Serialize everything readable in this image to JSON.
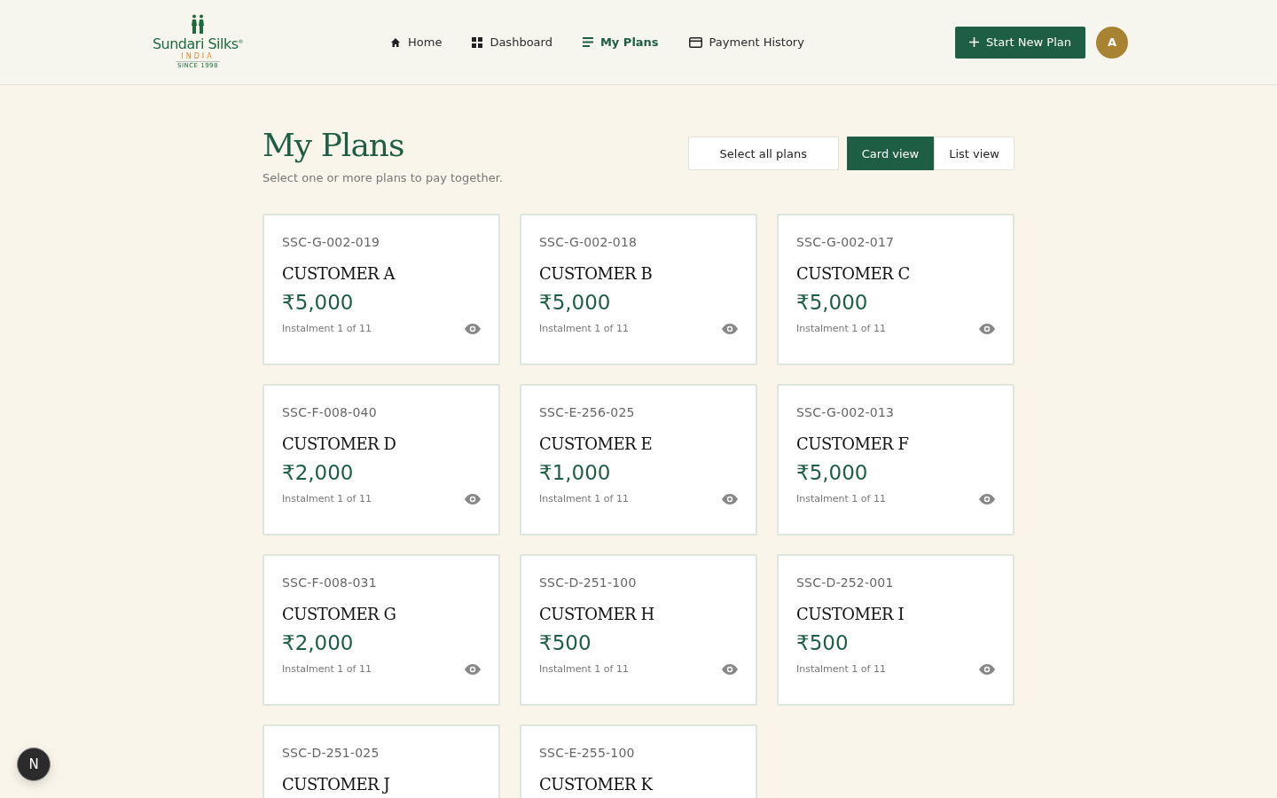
{
  "header": {
    "logo": {
      "name": "Sundari Silks",
      "mark": "®",
      "country": "INDIA",
      "since": "SINCE 1998"
    },
    "nav": [
      {
        "label": "Home",
        "selected": false
      },
      {
        "label": "Dashboard",
        "selected": false
      },
      {
        "label": "My Plans",
        "selected": true
      },
      {
        "label": "Payment History",
        "selected": false
      }
    ],
    "action": "Start New Plan",
    "avatar": "A"
  },
  "page": {
    "title": "My Plans",
    "subtitle": "Select one or more plans to pay together.",
    "select_all": "Select all plans",
    "views": [
      {
        "label": "Card view",
        "selected": true
      },
      {
        "label": "List view",
        "selected": false
      }
    ]
  },
  "plans": [
    {
      "code": "SSC-G-002-019",
      "customer": "CUSTOMER A",
      "amount": "₹5,000",
      "instalment": "Instalment 1 of 11"
    },
    {
      "code": "SSC-G-002-018",
      "customer": "CUSTOMER B",
      "amount": "₹5,000",
      "instalment": "Instalment 1 of 11"
    },
    {
      "code": "SSC-G-002-017",
      "customer": "CUSTOMER C",
      "amount": "₹5,000",
      "instalment": "Instalment 1 of 11"
    },
    {
      "code": "SSC-F-008-040",
      "customer": "CUSTOMER D",
      "amount": "₹2,000",
      "instalment": "Instalment 1 of 11"
    },
    {
      "code": "SSC-E-256-025",
      "customer": "CUSTOMER E",
      "amount": "₹1,000",
      "instalment": "Instalment 1 of 11"
    },
    {
      "code": "SSC-G-002-013",
      "customer": "CUSTOMER F",
      "amount": "₹5,000",
      "instalment": "Instalment 1 of 11"
    },
    {
      "code": "SSC-F-008-031",
      "customer": "CUSTOMER G",
      "amount": "₹2,000",
      "instalment": "Instalment 1 of 11"
    },
    {
      "code": "SSC-D-251-100",
      "customer": "CUSTOMER H",
      "amount": "₹500",
      "instalment": "Instalment 1 of 11"
    },
    {
      "code": "SSC-D-252-001",
      "customer": "CUSTOMER I",
      "amount": "₹500",
      "instalment": "Instalment 1 of 11"
    },
    {
      "code": "SSC-D-251-025",
      "customer": "CUSTOMER J"
    },
    {
      "code": "SSC-E-255-100",
      "customer": "CUSTOMER K"
    }
  ],
  "dev_badge": "N"
}
